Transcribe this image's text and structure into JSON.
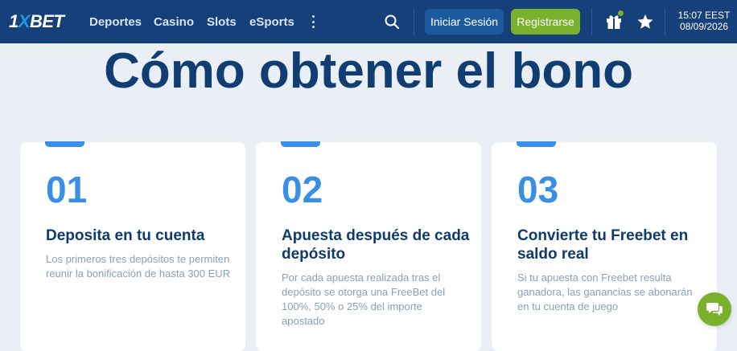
{
  "header": {
    "logo": {
      "one": "1",
      "x": "X",
      "bet": "BET"
    },
    "nav": [
      "Deportes",
      "Casino",
      "Slots",
      "eSports"
    ],
    "login_label": "Iniciar Sesión",
    "register_label": "Registrarse",
    "time": "15:07 EEST",
    "date": "08/09/2026"
  },
  "main": {
    "title": "Cómo obtener el bono",
    "steps": [
      {
        "number": "01",
        "title": "Deposita en tu cuenta",
        "text": "Los primeros tres depósitos te permiten reunir la bonificación de hasta 300 EUR"
      },
      {
        "number": "02",
        "title": "Apuesta después de cada depósito",
        "text": "Por cada apuesta realizada tras el depósito se otorga una FreeBet del 100%, 50% o 25% del importe apostado"
      },
      {
        "number": "03",
        "title": "Convierte tu Freebet en saldo real",
        "text": "Si tu apuesta con Freebet resulta ganadora, las ganancias se abonarán en tu cuenta de juego"
      }
    ]
  },
  "colors": {
    "header_bg": "#15407a",
    "accent_blue": "#3a8ee6",
    "register_green": "#7ab02c",
    "title_navy": "#103d72"
  },
  "icons": [
    "more-vertical-icon",
    "search-icon",
    "gift-icon",
    "star-icon",
    "chat-icon"
  ]
}
